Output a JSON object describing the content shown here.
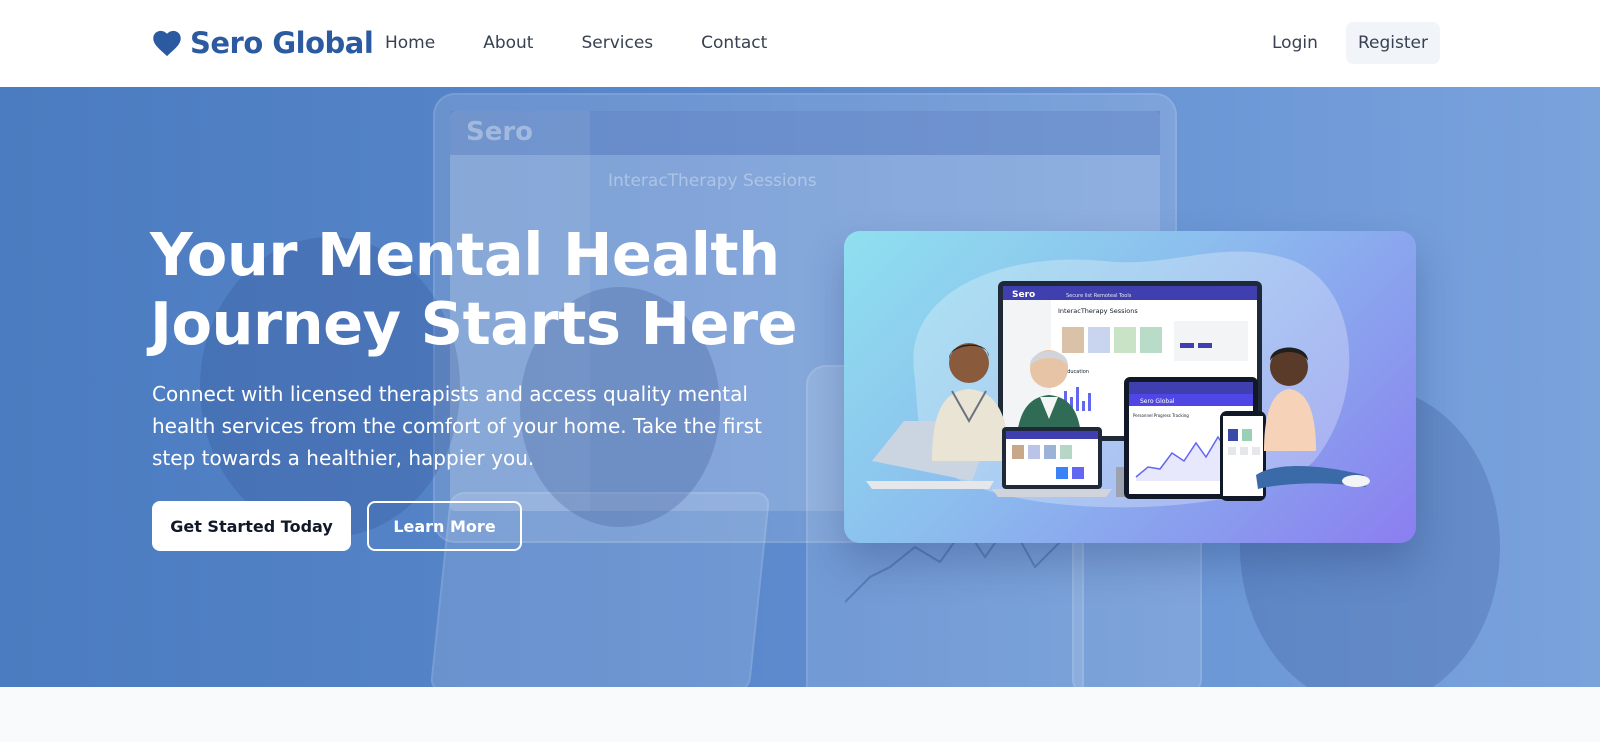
{
  "header": {
    "brand": "Sero Global",
    "brand_icon": "heart-icon",
    "brand_color": "#2c5aa0",
    "nav": [
      "Home",
      "About",
      "Services",
      "Contact"
    ],
    "login_label": "Login",
    "register_label": "Register"
  },
  "hero": {
    "headline_line1": "Your Mental Health",
    "headline_line2": "Journey Starts Here",
    "subtext": "Connect with licensed therapists and access quality mental health services from the comfort of your home. Take the first step towards a healthier, happier you.",
    "primary_cta": "Get Started Today",
    "secondary_cta": "Learn More",
    "bg_color": "#5a88cc"
  },
  "hero_image": {
    "app_name": "Sero",
    "app_tagline": "Secure list Remoteal Tools",
    "sessions_title": "InteracTherapy Sessions",
    "section_education": "al Education",
    "tablet_brand": "Sero Global",
    "chart_label": "Personnel Progress Tracking"
  }
}
